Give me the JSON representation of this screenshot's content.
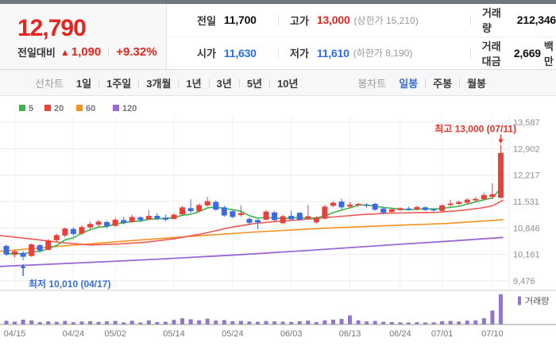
{
  "header": {
    "price": "12,790",
    "change_label": "전일대비",
    "change_arrow": "▲",
    "change_value": "1,090",
    "change_percent": "+9.32%",
    "stats": {
      "prev_label": "전일",
      "prev_value": "11,700",
      "high_label": "고가",
      "high_value": "13,000",
      "high_limit": "(상한가 15,210)",
      "volume_label": "거래량",
      "volume_value": "212,346",
      "open_label": "시가",
      "open_value": "11,630",
      "low_label": "저가",
      "low_value": "11,610",
      "low_limit": "(하한가 8,190)",
      "amount_label": "거래대금",
      "amount_value": "2,669",
      "amount_unit": "백만"
    }
  },
  "toolbar": {
    "line_chart_label": "선차트",
    "periods": [
      "1일",
      "1주일",
      "3개월",
      "1년",
      "3년",
      "5년",
      "10년"
    ],
    "candle_chart_label": "봉차트",
    "candle_modes": [
      "일봉",
      "주봉",
      "월봉"
    ],
    "selected_mode": "일봉"
  },
  "chart_data": {
    "type": "candlestick",
    "title": "일봉 주가 차트",
    "legend": [
      {
        "label": "5",
        "color": "#3eb24a"
      },
      {
        "label": "20",
        "color": "#e8403a"
      },
      {
        "label": "60",
        "color": "#f5901f"
      },
      {
        "label": "120",
        "color": "#9b68d4"
      }
    ],
    "volume_legend": "거래량",
    "colors": {
      "up": "#e8403a",
      "down": "#3b6be4",
      "ma5": "#3eb24a",
      "ma20": "#ef5a55",
      "ma60": "#f5901f",
      "ma120": "#9b68d4",
      "volume": "#9177c9"
    },
    "y_axis": {
      "ticks": [
        {
          "label": "13,587",
          "value": 13587
        },
        {
          "label": "12,902",
          "value": 12902
        },
        {
          "label": "12,217",
          "value": 12217
        },
        {
          "label": "11,531",
          "value": 11531
        },
        {
          "label": "10,846",
          "value": 10846
        },
        {
          "label": "10,161",
          "value": 10161
        },
        {
          "label": "9,476",
          "value": 9476
        }
      ]
    },
    "x_axis": {
      "ticks": [
        {
          "label": "04/15",
          "index": 1
        },
        {
          "label": "04/24",
          "index": 8
        },
        {
          "label": "05/02",
          "index": 13
        },
        {
          "label": "05/14",
          "index": 20
        },
        {
          "label": "05/24",
          "index": 27
        },
        {
          "label": "06/03",
          "index": 34
        },
        {
          "label": "06/13",
          "index": 41
        },
        {
          "label": "06/24",
          "index": 47
        },
        {
          "label": "07/01",
          "index": 52
        },
        {
          "label": "07/10",
          "index": 58
        }
      ]
    },
    "annotations": {
      "high": {
        "text": "최고 13,000 (07/11)",
        "value": 13000,
        "candle_index": 59,
        "color": "#e5332c"
      },
      "low": {
        "text": "최저 10,010 (04/17)",
        "value": 10010,
        "candle_index": 2,
        "color": "#3a6ee0"
      }
    },
    "candles_note": "each candle = [open, high, low, close, volume]",
    "candles": [
      [
        10380,
        10420,
        10120,
        10160,
        26000
      ],
      [
        10150,
        10280,
        10080,
        10240,
        20000
      ],
      [
        10200,
        10250,
        10010,
        10100,
        34000
      ],
      [
        10120,
        10450,
        10100,
        10420,
        28000
      ],
      [
        10400,
        10430,
        10210,
        10260,
        17000
      ],
      [
        10280,
        10560,
        10260,
        10520,
        22000
      ],
      [
        10530,
        10700,
        10480,
        10660,
        19000
      ],
      [
        10650,
        10860,
        10600,
        10830,
        25000
      ],
      [
        10820,
        10870,
        10640,
        10690,
        16000
      ],
      [
        10700,
        10910,
        10670,
        10870,
        21000
      ],
      [
        10860,
        11010,
        10820,
        10950,
        23000
      ],
      [
        10930,
        11060,
        10870,
        11010,
        18000
      ],
      [
        11000,
        11030,
        10840,
        10890,
        22000
      ],
      [
        10900,
        11110,
        10880,
        11060,
        25000
      ],
      [
        11050,
        11130,
        10940,
        10980,
        15000
      ],
      [
        11000,
        11190,
        10980,
        11130,
        26000
      ],
      [
        11120,
        11160,
        11010,
        11050,
        14000
      ],
      [
        11070,
        11310,
        11040,
        11160,
        29000
      ],
      [
        11160,
        11230,
        11050,
        11090,
        17000
      ],
      [
        11110,
        11190,
        11020,
        11060,
        19000
      ],
      [
        11080,
        11230,
        11060,
        11190,
        32000
      ],
      [
        11200,
        11420,
        11170,
        11380,
        44000
      ],
      [
        11360,
        11590,
        11230,
        11280,
        37000
      ],
      [
        11280,
        11480,
        11250,
        11440,
        29000
      ],
      [
        11430,
        11650,
        11400,
        11540,
        41000
      ],
      [
        11520,
        11560,
        11290,
        11320,
        27000
      ],
      [
        11380,
        11430,
        11130,
        11170,
        31000
      ],
      [
        11280,
        11320,
        11100,
        11130,
        23000
      ],
      [
        11180,
        11430,
        11140,
        11230,
        25000
      ],
      [
        11080,
        11120,
        10940,
        10980,
        21000
      ],
      [
        11050,
        11080,
        10820,
        10990,
        19000
      ],
      [
        11060,
        11310,
        11030,
        11270,
        24000
      ],
      [
        11250,
        11290,
        11010,
        11050,
        22000
      ],
      [
        10970,
        11190,
        10940,
        11150,
        20000
      ],
      [
        11160,
        11290,
        11040,
        11070,
        18000
      ],
      [
        11240,
        11260,
        11030,
        11060,
        23000
      ],
      [
        11100,
        11440,
        11070,
        11150,
        27000
      ],
      [
        10990,
        11150,
        10960,
        11110,
        17000
      ],
      [
        11090,
        11450,
        11060,
        11400,
        29000
      ],
      [
        11420,
        11540,
        11390,
        11500,
        34000
      ],
      [
        11530,
        11600,
        11330,
        11380,
        39000
      ],
      [
        11400,
        11520,
        11360,
        11450,
        64000
      ],
      [
        11440,
        11500,
        11390,
        11470,
        29000
      ],
      [
        11450,
        11490,
        11370,
        11420,
        21000
      ],
      [
        11470,
        11500,
        11290,
        11320,
        25000
      ],
      [
        11350,
        11390,
        11200,
        11240,
        19000
      ],
      [
        11260,
        11350,
        11230,
        11330,
        17000
      ],
      [
        11310,
        11380,
        11280,
        11360,
        15000
      ],
      [
        11350,
        11400,
        11300,
        11330,
        13000
      ],
      [
        11330,
        11420,
        11300,
        11390,
        16000
      ],
      [
        11380,
        11410,
        11290,
        11310,
        14000
      ],
      [
        11330,
        11360,
        11260,
        11300,
        15000
      ],
      [
        11290,
        11460,
        11270,
        11430,
        23000
      ],
      [
        11440,
        11580,
        11410,
        11480,
        25000
      ],
      [
        11470,
        11560,
        11440,
        11520,
        21000
      ],
      [
        11500,
        11620,
        11470,
        11580,
        27000
      ],
      [
        11560,
        11650,
        11530,
        11600,
        29000
      ],
      [
        11590,
        11760,
        11560,
        11700,
        44000
      ],
      [
        11650,
        12000,
        11600,
        11720,
        98000
      ],
      [
        11630,
        13000,
        11610,
        12790,
        212346
      ]
    ],
    "ma20_points": [
      [
        0,
        10650
      ],
      [
        40,
        10560
      ],
      [
        80,
        10460
      ],
      [
        115,
        10405
      ],
      [
        150,
        10430
      ],
      [
        185,
        10480
      ],
      [
        220,
        10570
      ],
      [
        255,
        10700
      ],
      [
        290,
        10860
      ],
      [
        320,
        10960
      ],
      [
        350,
        11020
      ],
      [
        385,
        11070
      ],
      [
        420,
        11130
      ],
      [
        455,
        11190
      ],
      [
        490,
        11230
      ],
      [
        520,
        11240
      ],
      [
        550,
        11250
      ],
      [
        580,
        11300
      ],
      [
        605,
        11360
      ],
      [
        620,
        11420
      ],
      [
        633,
        11560
      ]
    ],
    "ma60_points": [
      [
        0,
        10240
      ],
      [
        80,
        10380
      ],
      [
        160,
        10510
      ],
      [
        240,
        10630
      ],
      [
        320,
        10740
      ],
      [
        400,
        10830
      ],
      [
        480,
        10900
      ],
      [
        560,
        10960
      ],
      [
        633,
        11060
      ]
    ],
    "ma120_points": [
      [
        0,
        9850
      ],
      [
        100,
        9940
      ],
      [
        200,
        10040
      ],
      [
        300,
        10150
      ],
      [
        400,
        10280
      ],
      [
        500,
        10420
      ],
      [
        570,
        10510
      ],
      [
        633,
        10600
      ]
    ]
  }
}
